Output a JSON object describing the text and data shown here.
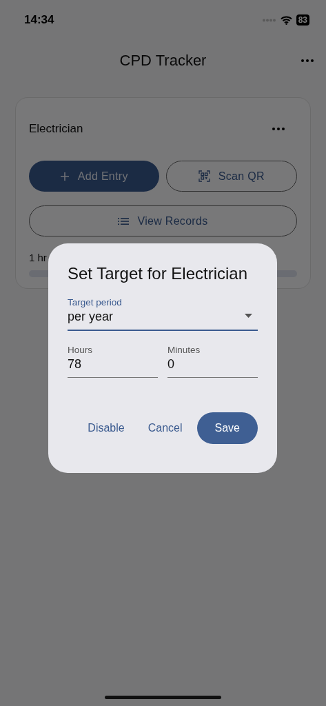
{
  "status_bar": {
    "time": "14:34",
    "battery": "83"
  },
  "app_bar": {
    "title": "CPD Tracker"
  },
  "card": {
    "title": "Electrician",
    "buttons": [
      {
        "label": "Add Entry",
        "kind": "filled"
      },
      {
        "label": "Scan QR",
        "kind": "outlined"
      },
      {
        "label": "View Records",
        "kind": "outlined"
      }
    ],
    "progress_text": "1 hr"
  },
  "dialog": {
    "title": "Set Target for Electrician",
    "period_field": {
      "label": "Target period",
      "value": "per year"
    },
    "fields": [
      {
        "label": "Hours",
        "value": "78"
      },
      {
        "label": "Minutes",
        "value": "0"
      }
    ],
    "actions": [
      {
        "label": "Disable",
        "kind": "text"
      },
      {
        "label": "Cancel",
        "kind": "text"
      },
      {
        "label": "Save",
        "kind": "filled"
      }
    ]
  }
}
